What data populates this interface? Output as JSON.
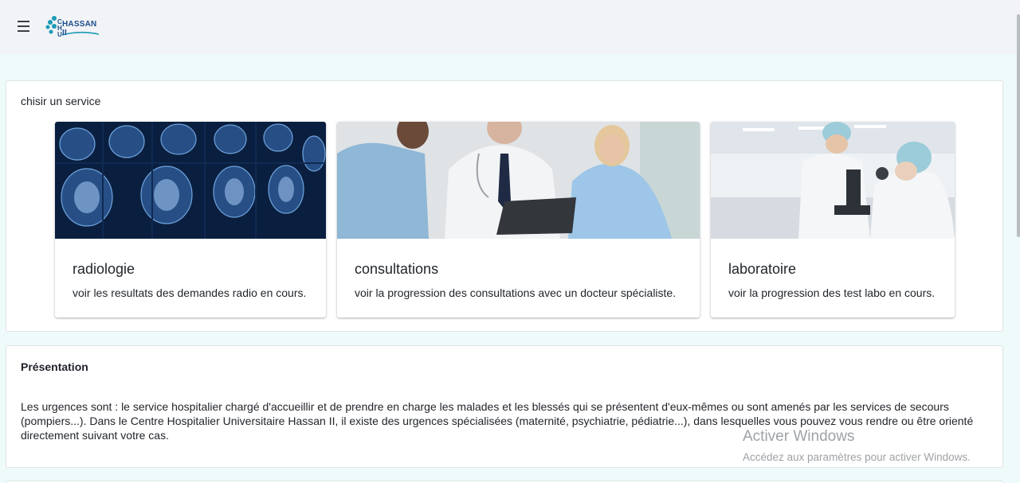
{
  "header": {
    "logo_text": "HASSAN II",
    "logo_monogram": "CHU"
  },
  "services": {
    "title": "chisir un service",
    "cards": [
      {
        "title": "radiologie",
        "description": "voir les resultats des demandes radio en cours.",
        "image": "mri-brain-scans-image"
      },
      {
        "title": "consultations",
        "description": "voir la progression des consultations avec un docteur spécialiste.",
        "image": "doctors-team-image"
      },
      {
        "title": "laboratoire",
        "description": "voir la progression des test labo en cours.",
        "image": "lab-technicians-image"
      }
    ]
  },
  "presentation": {
    "title": "Présentation",
    "text": "Les urgences sont : le service hospitalier chargé d'accueillir et de prendre en charge les malades et les blessés qui se présentent d'eux-mêmes ou sont amenés par les services de secours (pompiers...). Dans le Centre Hospitalier Universitaire Hassan II, il existe des urgences spécialisées (maternité, psychiatrie, pédiatrie...), dans lesquelles vous pouvez vous rendre ou être orienté directement suivant votre cas."
  },
  "watermark": {
    "title": "Activer Windows",
    "subtitle": "Accédez aux paramètres pour activer Windows."
  },
  "colors": {
    "page_background": "#effafa",
    "appbar_background": "#f1f3f6",
    "logo_blue": "#1b4d8c",
    "logo_teal": "#1a9bb5"
  }
}
